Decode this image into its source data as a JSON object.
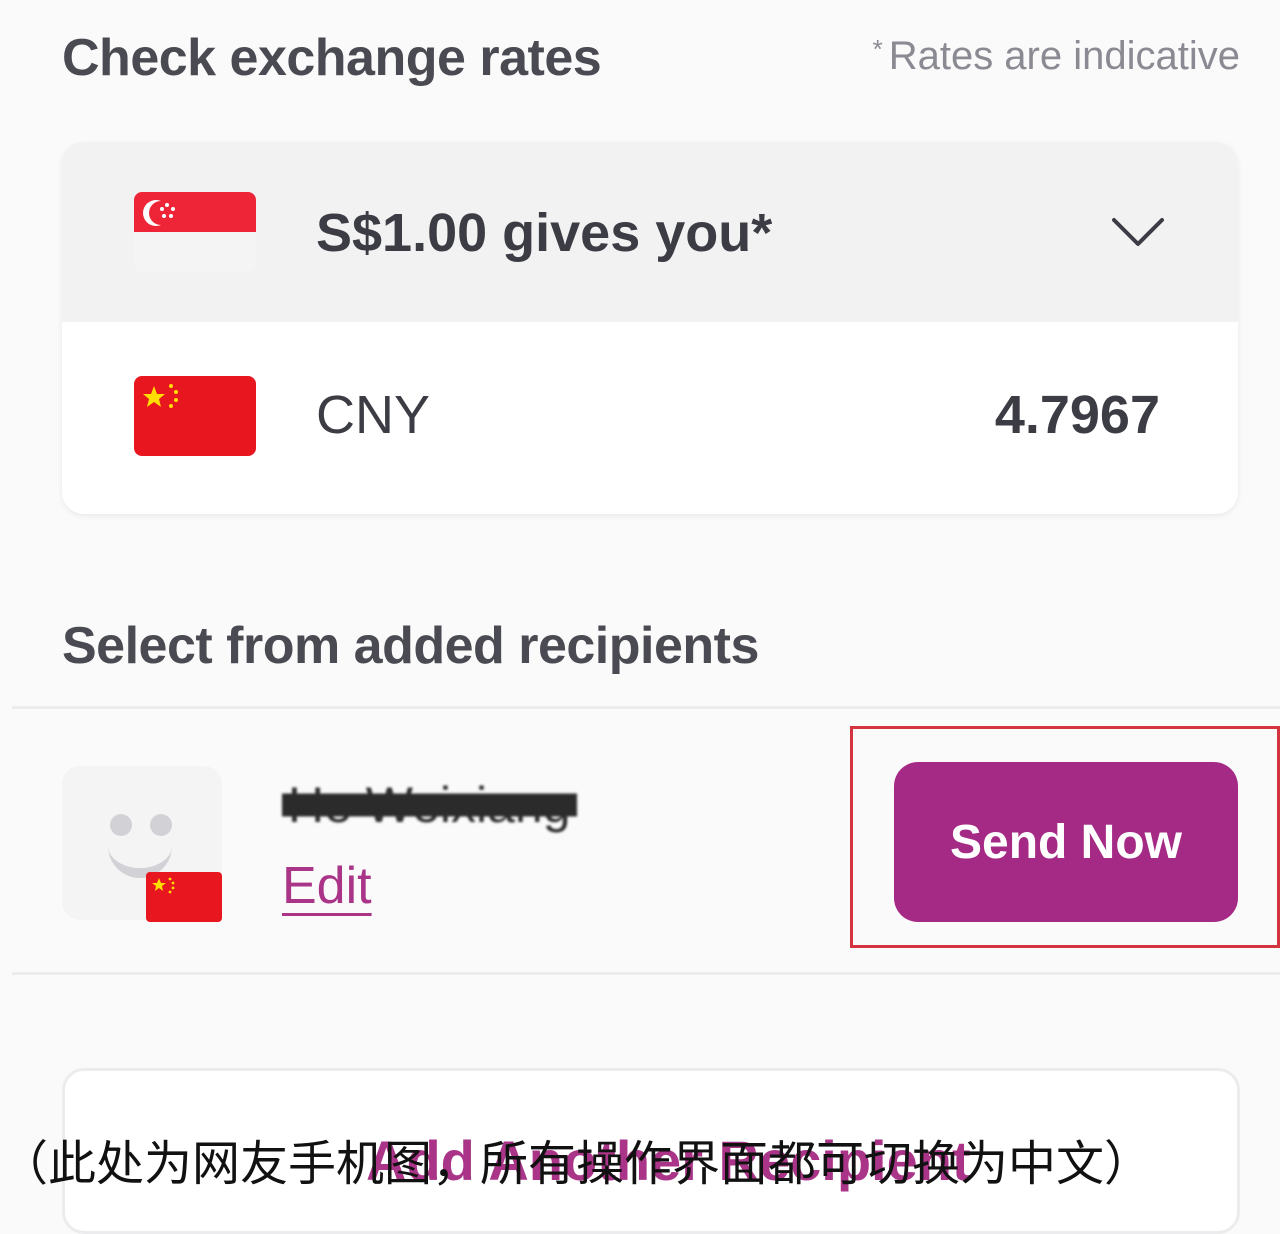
{
  "exchange": {
    "title": "Check exchange rates",
    "note_mark": "*",
    "note": "Rates are indicative",
    "source_label": "S$1.00 gives you*",
    "target_currency": "CNY",
    "target_rate": "4.7967"
  },
  "recipients": {
    "title": "Select from added recipients",
    "items": [
      {
        "name": "He Weixiang",
        "edit_label": "Edit",
        "send_label": "Send Now"
      }
    ],
    "add_label": "Add Another Recipient"
  },
  "caption": "（此处为网友手机图，所有操作界面都可切换为中文）",
  "colors": {
    "accent": "#a52a86",
    "link": "#a93488",
    "highlight": "#d3343d"
  }
}
